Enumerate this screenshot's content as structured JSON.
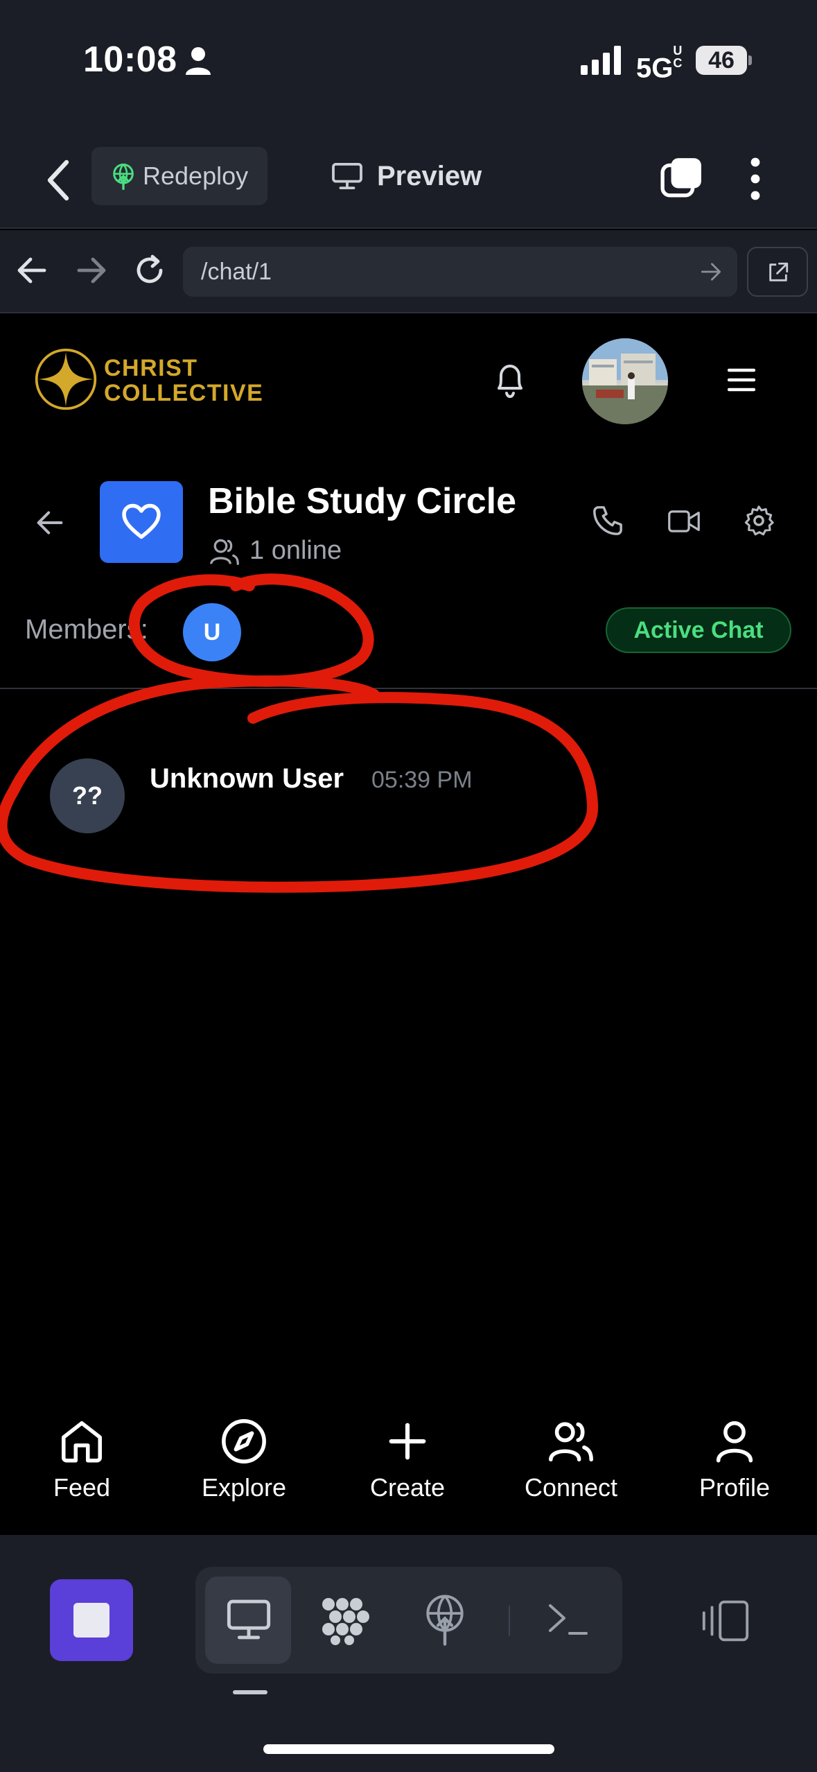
{
  "status_bar": {
    "time": "10:08",
    "network": "5G",
    "network_sup": "UC",
    "battery": "46"
  },
  "toolbar": {
    "redeploy_label": "Redeploy",
    "preview_label": "Preview"
  },
  "url_bar": {
    "url": "/chat/1"
  },
  "app_header": {
    "logo_line1": "CHRIST",
    "logo_line2": "COLLECTIVE"
  },
  "chat": {
    "title": "Bible Study Circle",
    "online_text": "1 online",
    "members_label": "Members:",
    "member_initial": "U",
    "status_badge": "Active Chat"
  },
  "messages": [
    {
      "author": "Unknown User",
      "time": "05:39 PM",
      "avatar_text": "??"
    }
  ],
  "bottom_nav": [
    {
      "label": "Feed",
      "icon": "home-icon"
    },
    {
      "label": "Explore",
      "icon": "compass-icon"
    },
    {
      "label": "Create",
      "icon": "plus-icon"
    },
    {
      "label": "Connect",
      "icon": "users-icon"
    },
    {
      "label": "Profile",
      "icon": "user-icon"
    }
  ],
  "colors": {
    "background": "#000000",
    "chrome": "#1b1e26",
    "brand_gold": "#d4a82a",
    "accent_blue": "#2f6df2",
    "active_green": "#4ade80",
    "stop_purple": "#5b3fd9",
    "annotation_red": "#e01b0a"
  },
  "annotations": {
    "type": "hand-drawn red circles",
    "targets": [
      "member-avatar",
      "message-item"
    ]
  }
}
